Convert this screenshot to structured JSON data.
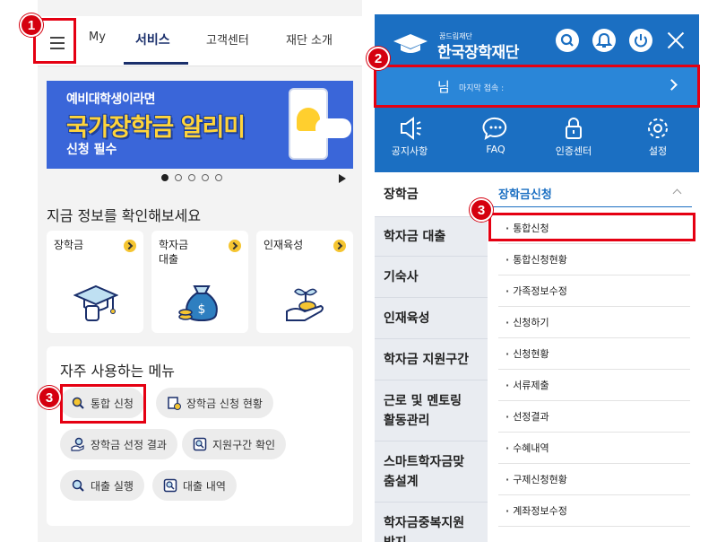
{
  "left": {
    "tabs": [
      {
        "label": "My"
      },
      {
        "label": "서비스"
      },
      {
        "label": "고객센터"
      },
      {
        "label": "재단 소개"
      }
    ],
    "banner": {
      "line1": "예비대학생이라면",
      "line2": "국가장학금 알리미",
      "line3": "신청 필수"
    },
    "carousel": {
      "current": 1,
      "total": 5
    },
    "info_title": "지금 정보를 확인해보세요",
    "cards": [
      {
        "label": "장학금",
        "icon": "graduation-cap-hand-icon"
      },
      {
        "label": "학자금\n대출",
        "icon": "money-bag-icon"
      },
      {
        "label": "인재육성",
        "icon": "sprout-hand-icon"
      }
    ],
    "frequent": {
      "title": "자주 사용하는 메뉴",
      "chips": [
        {
          "label": "통합 신청"
        },
        {
          "label": "장학금 신청 현황"
        },
        {
          "label": "장학금 선정 결과"
        },
        {
          "label": "지원구간 확인"
        },
        {
          "label": "대출 실행"
        },
        {
          "label": "대출 내역"
        }
      ]
    }
  },
  "right": {
    "logo": {
      "small": "꿈드림재단",
      "big": "한국장학재단"
    },
    "user": {
      "name": "님",
      "last_login": "마지막 접속 :"
    },
    "quick_links": [
      {
        "label": "공지사항",
        "icon": "megaphone-icon"
      },
      {
        "label": "FAQ",
        "icon": "chat-bubble-icon"
      },
      {
        "label": "인증센터",
        "icon": "lock-icon"
      },
      {
        "label": "설정",
        "icon": "gear-icon"
      }
    ],
    "sidebar": [
      {
        "label": "장학금"
      },
      {
        "label": "학자금 대출"
      },
      {
        "label": "기숙사"
      },
      {
        "label": "인재육성"
      },
      {
        "label": "학자금 지원구간"
      },
      {
        "label": "근로 및 멘토링\n활동관리"
      },
      {
        "label": "스마트학자금맞\n춤설계"
      },
      {
        "label": "학자금중복지원\n방지"
      }
    ],
    "submenu": {
      "title": "장학금신청",
      "items": [
        {
          "label": "통합신청"
        },
        {
          "label": "통합신청현황"
        },
        {
          "label": "가족정보수정"
        },
        {
          "label": "신청하기"
        },
        {
          "label": "신청현황"
        },
        {
          "label": "서류제출"
        },
        {
          "label": "선정결과"
        },
        {
          "label": "수혜내역"
        },
        {
          "label": "구제신청현황"
        },
        {
          "label": "계좌정보수정"
        }
      ]
    }
  },
  "annotations": [
    {
      "number": "1"
    },
    {
      "number": "2"
    },
    {
      "number": "3"
    },
    {
      "number": "3"
    }
  ],
  "colors": {
    "navy": "#1a2f6b",
    "brand_blue": "#1b6fc2",
    "highlight_red": "#e50012",
    "chevron_yellow": "#f5c531"
  }
}
